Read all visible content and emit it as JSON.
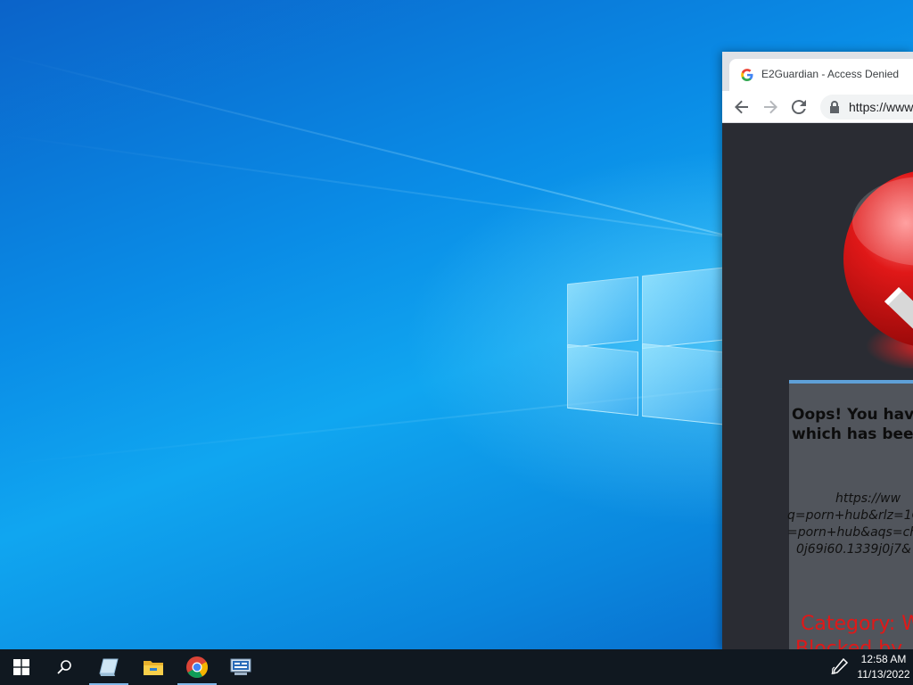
{
  "browser": {
    "tab_title": "E2Guardian - Access Denied",
    "url": "https://www",
    "page": {
      "message_line1": "Oops! You have",
      "message_line2": "which has been",
      "blocked_url_lines": [
        "https://ww",
        "q=porn+hub&rlz=1C",
        "=porn+hub&aqs=chr",
        "0j69i60.1339j0j7&"
      ],
      "category_line1": "Category: W",
      "category_line2": "Blocked by"
    }
  },
  "taskbar": {
    "icons": [
      "windows-start-icon",
      "search-icon",
      "blank-icon",
      "file-explorer-icon",
      "chrome-icon",
      "network-icon"
    ],
    "clock_time": "12:58 AM",
    "clock_date": "11/13/2022"
  },
  "colors": {
    "desktop": "#0a8ce6",
    "taskbar": "#101820",
    "page_bg": "#2a2c33",
    "message_box": "#51555c",
    "category_red": "#e01818"
  }
}
